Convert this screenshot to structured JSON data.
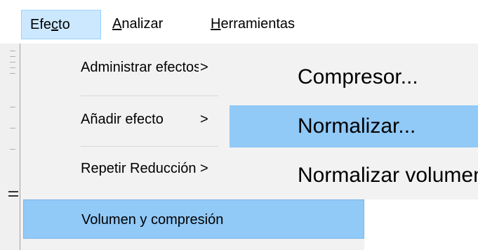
{
  "menubar": {
    "items": [
      {
        "pre": "Efe",
        "ul": "c",
        "post": "to"
      },
      {
        "pre": "",
        "ul": "A",
        "post": "nalizar"
      },
      {
        "pre": "",
        "ul": "H",
        "post": "erramientas"
      }
    ]
  },
  "effect_menu": {
    "items": [
      {
        "label": "Administrar efectos",
        "arrow": ">"
      },
      {
        "label": "Añadir efecto",
        "arrow": ">"
      },
      {
        "label": "Repetir Reducción de ruido",
        "arrow": ">"
      },
      {
        "label": "Volumen y compresión",
        "arrow": ">"
      }
    ]
  },
  "volume_submenu": {
    "items": [
      {
        "label": "Compresor..."
      },
      {
        "label": "Normalizar..."
      },
      {
        "label": "Normalizar volumen"
      }
    ]
  },
  "colors": {
    "highlight": "#91c9f7",
    "menubar_active": "#cce8ff",
    "menu_bg": "#f2f2f2"
  }
}
